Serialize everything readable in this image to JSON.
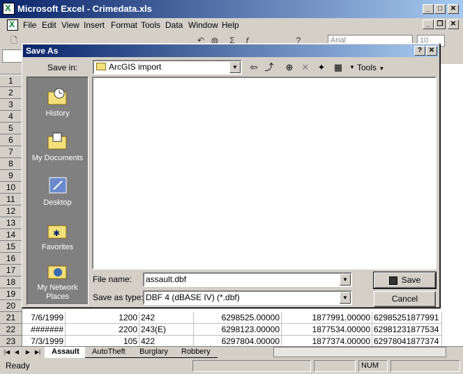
{
  "window": {
    "title": "Microsoft Excel - Crimedata.xls",
    "min": "_",
    "max": "□",
    "close": "✕",
    "doc_min": "_",
    "doc_restore": "❐",
    "doc_close": "✕"
  },
  "menu": [
    {
      "label": "File"
    },
    {
      "label": "Edit"
    },
    {
      "label": "View"
    },
    {
      "label": "Insert"
    },
    {
      "label": "Format"
    },
    {
      "label": "Tools"
    },
    {
      "label": "Data"
    },
    {
      "label": "Window"
    },
    {
      "label": "Help"
    }
  ],
  "toolbar": {
    "font": "Arial",
    "size": "10"
  },
  "rows": {
    "headers": [
      "1",
      "2",
      "3",
      "4",
      "5",
      "6",
      "7",
      "8",
      "9",
      "10",
      "11",
      "12",
      "13",
      "14",
      "15",
      "16",
      "17",
      "18",
      "19",
      "20",
      "21",
      "22",
      "23"
    ],
    "data": [
      {
        "row": "21",
        "date": "7/6/1999",
        "b": "1200",
        "c": "242",
        "d": "6298525.00000",
        "e": "1877991.00000",
        "f": "62985251877991"
      },
      {
        "row": "22",
        "date": "#######",
        "b": "2200",
        "c": "243(E)",
        "d": "6298123.00000",
        "e": "1877534.00000",
        "f": "62981231877534"
      },
      {
        "row": "23",
        "date": "7/3/1999",
        "b": "105",
        "c": "422",
        "d": "6297804.00000",
        "e": "1877374.00000",
        "f": "62978041877374"
      }
    ]
  },
  "sheet_tabs": [
    "Assault",
    "AutoTheft",
    "Burglary",
    "Robbery"
  ],
  "status": {
    "text": "Ready",
    "num": "NUM"
  },
  "dialog": {
    "title": "Save As",
    "help": "?",
    "close": "✕",
    "save_in_label": "Save in:",
    "save_in_value": "ArcGIS import",
    "tools_label": "Tools",
    "places": [
      "History",
      "My Documents",
      "Desktop",
      "Favorites",
      "My Network Places"
    ],
    "file_name_label": "File name:",
    "file_name_value": "assault.dbf",
    "save_type_label": "Save as type:",
    "save_type_value": "DBF 4 (dBASE IV) (*.dbf)",
    "save_button": "Save",
    "cancel_button": "Cancel"
  },
  "colors": {
    "titlebar": "#0a246a",
    "face": "#d4d0c8",
    "places_bg": "#808080"
  }
}
